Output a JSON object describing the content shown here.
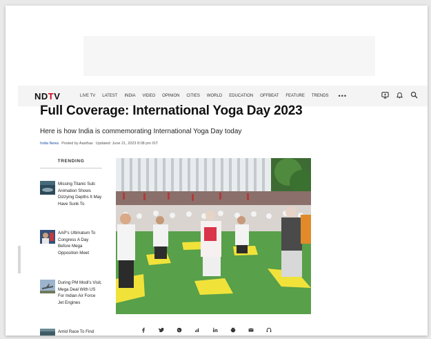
{
  "nav": {
    "logo": "NDTV",
    "items": [
      "LIVE TV",
      "LATEST",
      "INDIA",
      "VIDEO",
      "OPINION",
      "CITIES",
      "WORLD",
      "EDUCATION",
      "OFFBEAT",
      "FEATURE",
      "TRENDS"
    ],
    "more": "•••",
    "icons": [
      "tv-icon",
      "bell-icon",
      "search-icon"
    ]
  },
  "article": {
    "headline": "Full Coverage: International Yoga Day 2023",
    "subhead": "Here is how India is commemorating International Yoga Day today",
    "source": "India News",
    "posted_by": "Posted by Aasthas",
    "updated": "Updated: June 21, 2023 8:08 pm IST"
  },
  "trending": {
    "title": "TRENDING",
    "items": [
      {
        "text": "Missing Titanic Sub: Animation Shows Dizzying Depths It May Have Sunk To",
        "thumb": "sub-thumb"
      },
      {
        "text": "AAP's Ultimatum To Congress A Day Before Mega Opposition Meet",
        "thumb": "politics-thumb"
      },
      {
        "text": "During PM Modi's Visit, Mega Deal With US For Indian Air Force Jet Engines",
        "thumb": "jet-thumb"
      },
      {
        "text": "Amid Race To Find",
        "thumb": "sub2-thumb"
      }
    ]
  },
  "share": [
    "facebook-icon",
    "twitter-icon",
    "whatsapp-icon",
    "reddit-icon",
    "linkedin-icon",
    "print-icon",
    "email-icon",
    "link-icon"
  ],
  "colors": {
    "brand_red": "#d0021b",
    "link_blue": "#1a4fa0"
  }
}
